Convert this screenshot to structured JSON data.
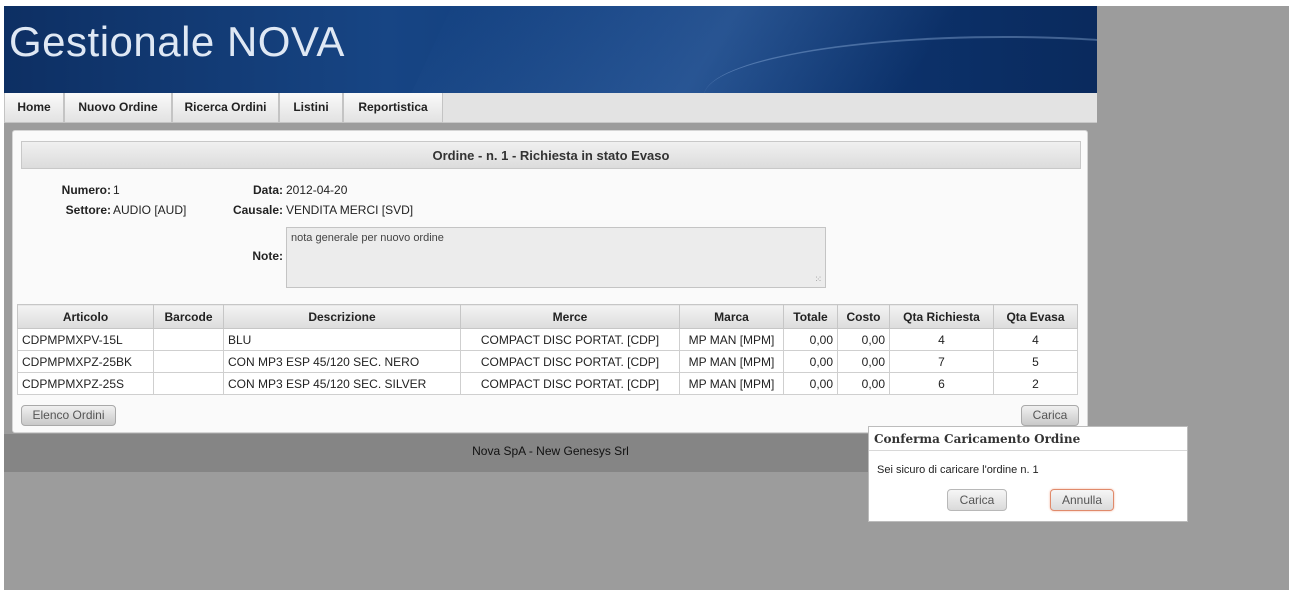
{
  "app": {
    "title": "Gestionale NOVA"
  },
  "menu": {
    "items": [
      {
        "label": "Home"
      },
      {
        "label": "Nuovo Ordine"
      },
      {
        "label": "Ricerca Ordini"
      },
      {
        "label": "Listini"
      },
      {
        "label": "Reportistica"
      }
    ]
  },
  "order": {
    "header": "Ordine - n. 1 - Richiesta in stato Evaso",
    "numero_label": "Numero:",
    "numero": "1",
    "settore_label": "Settore:",
    "settore": "AUDIO [AUD]",
    "data_label": "Data:",
    "data": "2012-04-20",
    "causale_label": "Causale:",
    "causale": "VENDITA MERCI [SVD]",
    "note_label": "Note:",
    "note": "nota generale per nuovo ordine"
  },
  "table": {
    "headers": [
      "Articolo",
      "Barcode",
      "Descrizione",
      "Merce",
      "Marca",
      "Totale",
      "Costo",
      "Qta Richiesta",
      "Qta Evasa"
    ],
    "rows": [
      [
        "CDPMPMXPV-15L",
        "",
        "BLU",
        "COMPACT DISC PORTAT. [CDP]",
        "MP MAN [MPM]",
        "0,00",
        "0,00",
        "4",
        "4"
      ],
      [
        "CDPMPMXPZ-25BK",
        "",
        "CON MP3 ESP 45/120 SEC. NERO",
        "COMPACT DISC PORTAT. [CDP]",
        "MP MAN [MPM]",
        "0,00",
        "0,00",
        "7",
        "5"
      ],
      [
        "CDPMPMXPZ-25S",
        "",
        "CON MP3 ESP 45/120 SEC. SILVER",
        "COMPACT DISC PORTAT. [CDP]",
        "MP MAN [MPM]",
        "0,00",
        "0,00",
        "6",
        "2"
      ]
    ]
  },
  "buttons": {
    "elenco": "Elenco Ordini",
    "carica": "Carica"
  },
  "footer": {
    "text": "Nova SpA - New Genesys Srl"
  },
  "dialog": {
    "title": "Conferma Caricamento Ordine",
    "message": "Sei sicuro di caricare l'ordine n. 1",
    "confirm": "Carica",
    "cancel": "Annulla"
  },
  "colors": {
    "banner": "#174584",
    "background": "#9c9c9c",
    "footer": "#858585",
    "cancel_border": "#e08a6b"
  }
}
